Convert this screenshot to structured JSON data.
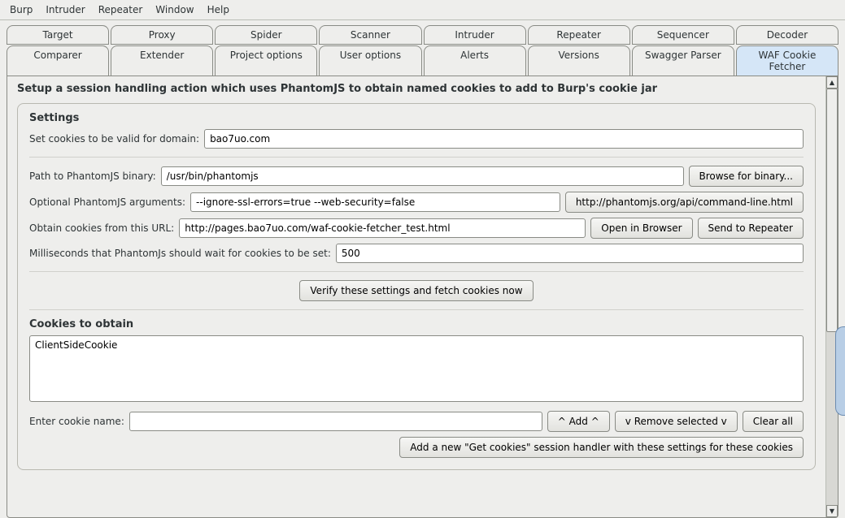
{
  "menu": {
    "items": [
      "Burp",
      "Intruder",
      "Repeater",
      "Window",
      "Help"
    ]
  },
  "tabs": {
    "row1": [
      "Target",
      "Proxy",
      "Spider",
      "Scanner",
      "Intruder",
      "Repeater",
      "Sequencer",
      "Decoder"
    ],
    "row2": [
      "Comparer",
      "Extender",
      "Project options",
      "User options",
      "Alerts",
      "Versions",
      "Swagger Parser",
      "WAF Cookie Fetcher"
    ],
    "active": "WAF Cookie Fetcher"
  },
  "heading": "Setup a session handling action which uses PhantomJS to obtain named cookies to add to Burp's cookie jar",
  "settings": {
    "title": "Settings",
    "domain_label": "Set cookies to be valid for domain:",
    "domain_value": "bao7uo.com",
    "binary_label": "Path to PhantomJS binary:",
    "binary_value": "/usr/bin/phantomjs",
    "browse_btn": "Browse for binary...",
    "args_label": "Optional PhantomJS arguments:",
    "args_value": "--ignore-ssl-errors=true --web-security=false",
    "args_doc_btn": "http://phantomjs.org/api/command-line.html",
    "url_label": "Obtain cookies from this URL:",
    "url_value": "http://pages.bao7uo.com/waf-cookie-fetcher_test.html",
    "open_btn": "Open in Browser",
    "send_btn": "Send to Repeater",
    "wait_label": "Milliseconds that PhantomJs should wait for cookies to be set:",
    "wait_value": "500",
    "verify_btn": "Verify these settings and fetch cookies now"
  },
  "cookies": {
    "title": "Cookies to obtain",
    "list": "ClientSideCookie",
    "enter_label": "Enter cookie name:",
    "enter_value": "",
    "add_btn": "^ Add ^",
    "remove_btn": "v Remove selected v",
    "clear_btn": "Clear all",
    "session_btn": "Add a new \"Get cookies\" session handler with these settings for these cookies"
  }
}
